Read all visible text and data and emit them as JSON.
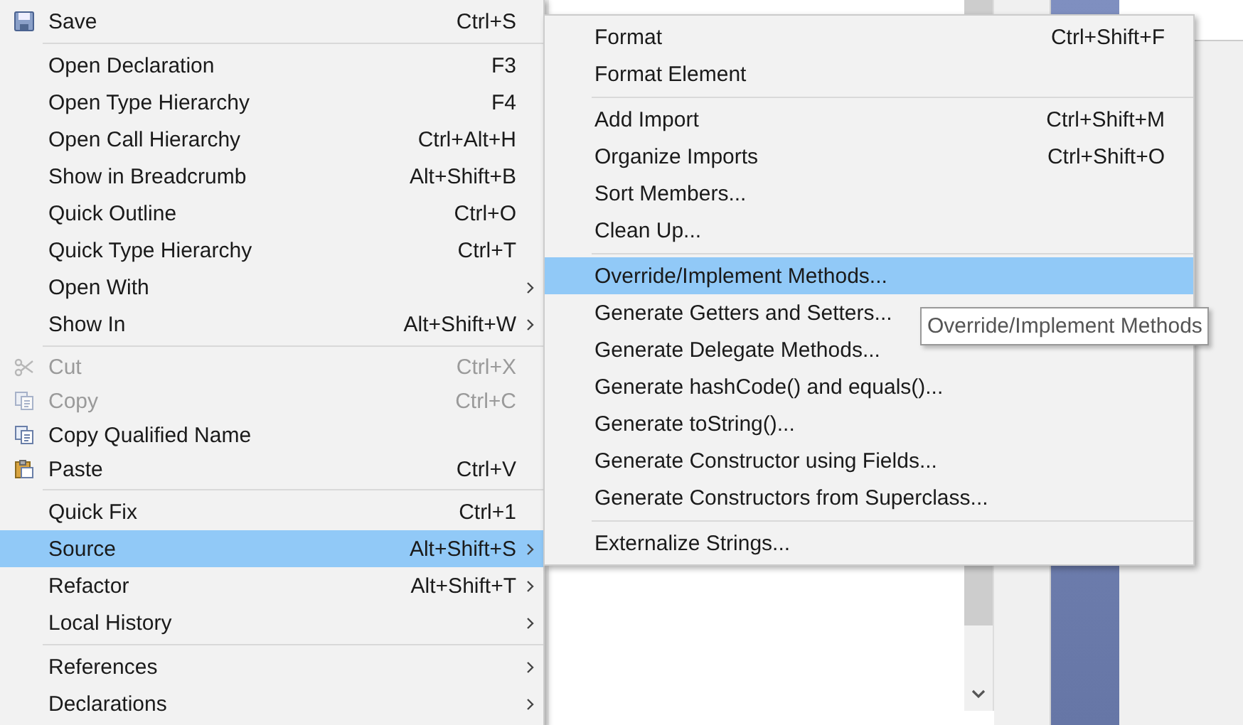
{
  "context_menu": {
    "groups": [
      [
        {
          "label": "Save",
          "shortcut": "Ctrl+S",
          "submenu": false,
          "disabled": false,
          "selected": false
        }
      ],
      [
        {
          "label": "Open Declaration",
          "shortcut": "F3",
          "submenu": false,
          "disabled": false,
          "selected": false
        },
        {
          "label": "Open Type Hierarchy",
          "shortcut": "F4",
          "submenu": false,
          "disabled": false,
          "selected": false
        },
        {
          "label": "Open Call Hierarchy",
          "shortcut": "Ctrl+Alt+H",
          "submenu": false,
          "disabled": false,
          "selected": false
        },
        {
          "label": "Show in Breadcrumb",
          "shortcut": "Alt+Shift+B",
          "submenu": false,
          "disabled": false,
          "selected": false
        },
        {
          "label": "Quick Outline",
          "shortcut": "Ctrl+O",
          "submenu": false,
          "disabled": false,
          "selected": false
        },
        {
          "label": "Quick Type Hierarchy",
          "shortcut": "Ctrl+T",
          "submenu": false,
          "disabled": false,
          "selected": false
        },
        {
          "label": "Open With",
          "submenu": true,
          "disabled": false,
          "selected": false
        },
        {
          "label": "Show In",
          "shortcut": "Alt+Shift+W",
          "submenu": true,
          "disabled": false,
          "selected": false
        }
      ],
      [
        {
          "label": "Cut",
          "shortcut": "Ctrl+X",
          "submenu": false,
          "disabled": true,
          "selected": false
        },
        {
          "label": "Copy",
          "shortcut": "Ctrl+C",
          "submenu": false,
          "disabled": true,
          "selected": false
        },
        {
          "label": "Copy Qualified Name",
          "submenu": false,
          "disabled": false,
          "selected": false
        },
        {
          "label": "Paste",
          "shortcut": "Ctrl+V",
          "submenu": false,
          "disabled": false,
          "selected": false
        }
      ],
      [
        {
          "label": "Quick Fix",
          "shortcut": "Ctrl+1",
          "submenu": false,
          "disabled": false,
          "selected": false
        },
        {
          "label": "Source",
          "shortcut": "Alt+Shift+S",
          "submenu": true,
          "disabled": false,
          "selected": true
        },
        {
          "label": "Refactor",
          "shortcut": "Alt+Shift+T",
          "submenu": true,
          "disabled": false,
          "selected": false
        },
        {
          "label": "Local History",
          "submenu": true,
          "disabled": false,
          "selected": false
        }
      ],
      [
        {
          "label": "References",
          "submenu": true,
          "disabled": false,
          "selected": false
        },
        {
          "label": "Declarations",
          "submenu": true,
          "disabled": false,
          "selected": false
        }
      ]
    ]
  },
  "source_submenu": {
    "groups": [
      [
        {
          "label": "Format",
          "shortcut": "Ctrl+Shift+F",
          "selected": false
        },
        {
          "label": "Format Element",
          "selected": false
        }
      ],
      [
        {
          "label": "Add Import",
          "shortcut": "Ctrl+Shift+M",
          "selected": false
        },
        {
          "label": "Organize Imports",
          "shortcut": "Ctrl+Shift+O",
          "selected": false
        },
        {
          "label": "Sort Members...",
          "selected": false
        },
        {
          "label": "Clean Up...",
          "selected": false
        }
      ],
      [
        {
          "label": "Override/Implement Methods...",
          "selected": true
        },
        {
          "label": "Generate Getters and Setters...",
          "selected": false
        },
        {
          "label": "Generate Delegate Methods...",
          "selected": false
        },
        {
          "label": "Generate hashCode() and equals()...",
          "selected": false
        },
        {
          "label": "Generate toString()...",
          "selected": false
        },
        {
          "label": "Generate Constructor using Fields...",
          "selected": false
        },
        {
          "label": "Generate Constructors from Superclass...",
          "selected": false
        }
      ],
      [
        {
          "label": "Externalize Strings...",
          "selected": false
        }
      ]
    ]
  },
  "tooltip": {
    "text": "Override/Implement Methods"
  }
}
